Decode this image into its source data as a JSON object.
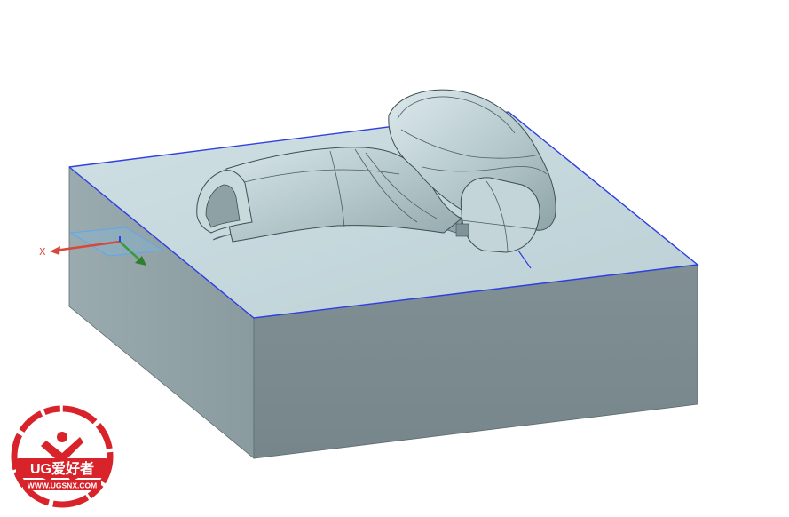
{
  "viewport": {
    "triad": {
      "x_axis_label": "X"
    }
  },
  "watermark": {
    "brand_text": "UG爱好者",
    "url_text": "WWW.UGSNX.COM",
    "color": "#d8232a"
  },
  "colors": {
    "block_top": "#c6d8dc",
    "block_front": "#7b8b8f",
    "block_left": "#95a6aa",
    "edge_highlight": "#2f3fe0",
    "part_surface": "#b8cbcf"
  }
}
